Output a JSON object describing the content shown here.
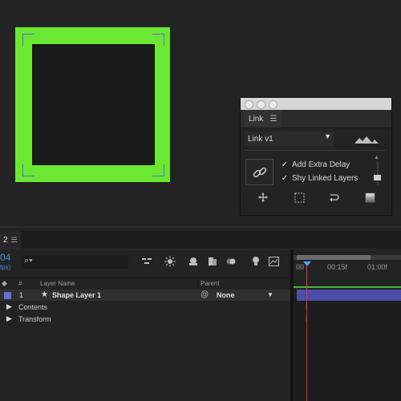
{
  "link_panel": {
    "tab_label": "Link",
    "preset": "Link v1",
    "checkbox_1": "Add Extra Delay",
    "checkbox_2": "Shy Linked Layers"
  },
  "timeline": {
    "tab_label": "2",
    "timecode": "04",
    "fps": "fps)",
    "columns": {
      "number": "#",
      "layer_name": "Layer Name",
      "parent": "Parent"
    },
    "layer": {
      "index": "1",
      "name": "Shape Layer 1",
      "parent_value": "None",
      "color": "#6a6ad8"
    },
    "sub_rows": [
      "Contents",
      "Transform"
    ],
    "ruler": {
      "start": "00",
      "mid": "00:15f",
      "end": "01:00f"
    }
  },
  "colors": {
    "shape_fill": "#6ae832",
    "selection_corners": "#5a6fd8",
    "timecode": "#3d8ae0",
    "playhead": "#d23a3a",
    "layer_bar": "#4c4ca6"
  },
  "icons": {
    "link": "chain-link-icon",
    "mountain": "mountain-icon",
    "move": "move-arrows-icon",
    "select": "dotted-rect-icon",
    "loop": "loop-arrow-icon",
    "gradient": "gradient-square-icon"
  }
}
